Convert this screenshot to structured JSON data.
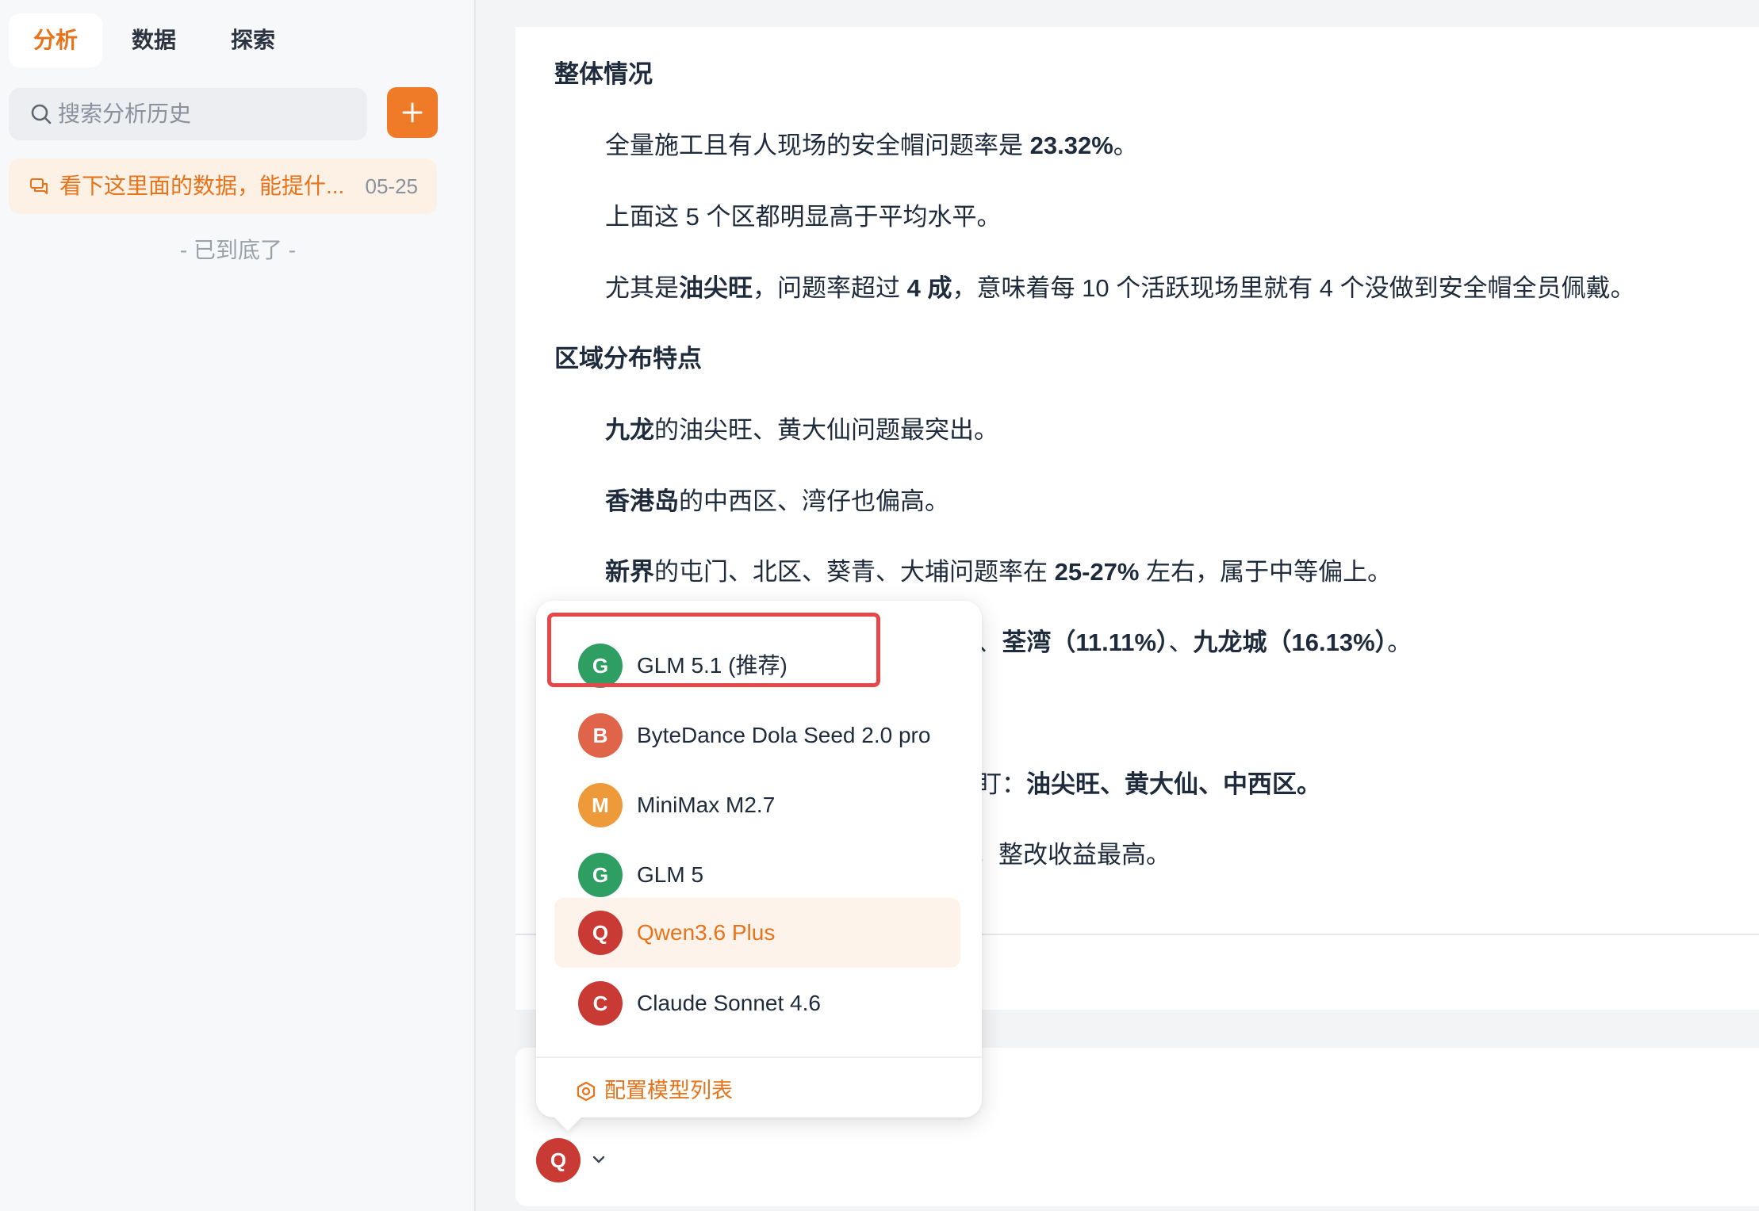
{
  "sidebar": {
    "tabs": [
      {
        "label": "分析"
      },
      {
        "label": "数据"
      },
      {
        "label": "探索"
      }
    ],
    "search_placeholder": "搜索分析历史",
    "history": [
      {
        "title": "看下这里面的数据，能提什...",
        "date": "05-25"
      }
    ],
    "end_note": "- 已到底了 -"
  },
  "report": {
    "heading1": "整体情况",
    "p1": {
      "text": "全量施工且有人现场的安全帽问题率是 ",
      "bold": "23.32%",
      "tail": "。"
    },
    "p2": "上面这 5 个区都明显高于平均水平。",
    "p3": {
      "a": "尤其是",
      "b1": "油尖旺",
      "c": "，问题率超过 ",
      "b2": "4 成",
      "d": "，意味着每 10 个活跃现场里就有 4 个没做到安全帽全员佩戴。"
    },
    "heading2": "区域分布特点",
    "p4": {
      "b": "九龙",
      "t": "的油尖旺、黄大仙问题最突出。"
    },
    "p5": {
      "b": "香港岛",
      "t": "的中西区、湾仔也偏高。"
    },
    "p6": {
      "b": "新界",
      "t1": "的屯门、北区、葵青、大埔问题率在 ",
      "b2": "25-27%",
      "t2": " 左右，属于中等偏上。"
    },
    "p7": {
      "a": ")、",
      "b1": "荃湾（11.11%）",
      "c": "、",
      "b2": "九龙城（16.13%）",
      "d": "。"
    },
    "p8": {
      "a": "盯：",
      "b": "油尖旺、黄大仙、中西区。"
    },
    "p9": "，整改收益最高。"
  },
  "model_menu": {
    "options": [
      {
        "initial": "G",
        "label": "GLM 5.1 (推荐)",
        "color": "#2f9e62"
      },
      {
        "initial": "B",
        "label": "ByteDance Dola Seed 2.0 pro",
        "color": "#e0644a"
      },
      {
        "initial": "M",
        "label": "MiniMax M2.7",
        "color": "#ef9a3a"
      },
      {
        "initial": "G",
        "label": "GLM 5",
        "color": "#2f9e62"
      },
      {
        "initial": "Q",
        "label": "Qwen3.6 Plus",
        "color": "#c93a34"
      },
      {
        "initial": "C",
        "label": "Claude Sonnet 4.6",
        "color": "#c93a34"
      }
    ],
    "selected": "Qwen3.6 Plus",
    "config_label": "配置模型列表"
  },
  "model_trigger": {
    "initial": "Q"
  },
  "colors": {
    "accent": "#e8731a",
    "highlight": "#e8474a"
  }
}
